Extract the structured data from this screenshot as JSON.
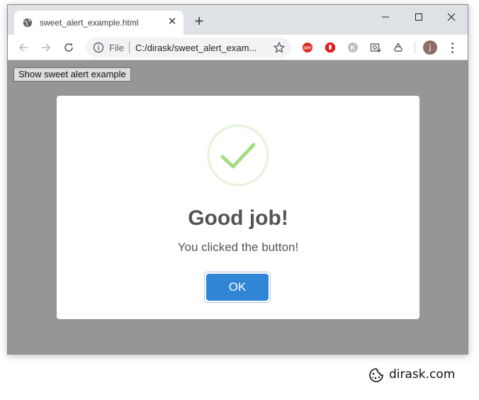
{
  "browser": {
    "tab_title": "sweet_alert_example.html",
    "tab_close": "✕",
    "new_tab": "+",
    "scheme": "File",
    "url": "C:/dirask/sweet_alert_exam...",
    "profile_initial": "j"
  },
  "page": {
    "button_label": "Show sweet alert example"
  },
  "alert": {
    "title": "Good job!",
    "text": "You clicked the button!",
    "ok_label": "OK",
    "icon": "success-checkmark",
    "accent_color": "#3085d6",
    "icon_color": "#a5dc86"
  },
  "branding": {
    "name": "dirask.com"
  }
}
